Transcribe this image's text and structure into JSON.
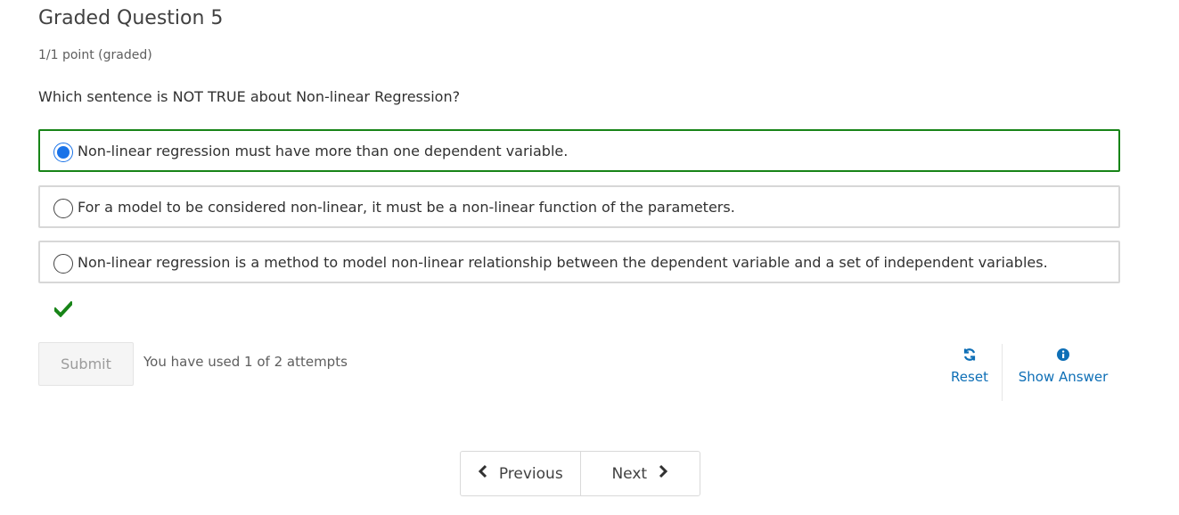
{
  "problem": {
    "title": "Graded Question 5",
    "score": "1/1 point (graded)",
    "question": "Which sentence is NOT TRUE about Non-linear Regression?",
    "options": [
      {
        "label": "Non-linear regression must have more than one dependent variable.",
        "selected": true
      },
      {
        "label": "For a model to be considered non-linear, it must be a non-linear function of the parameters.",
        "selected": false
      },
      {
        "label": "Non-linear regression is a method to model non-linear relationship between the dependent variable and a set of independent variables.",
        "selected": false
      }
    ],
    "result_icon": "check-icon"
  },
  "actions": {
    "submit_label": "Submit",
    "attempts_text": "You have used 1 of 2 attempts",
    "reset_label": "Reset",
    "reset_icon": "refresh-icon",
    "show_answer_label": "Show Answer",
    "show_answer_icon": "info-icon"
  },
  "navigation": {
    "previous_label": "Previous",
    "next_label": "Next"
  },
  "colors": {
    "correct_border": "#178417",
    "link": "#0e6fb6",
    "radio_selected": "#1a73e8"
  }
}
